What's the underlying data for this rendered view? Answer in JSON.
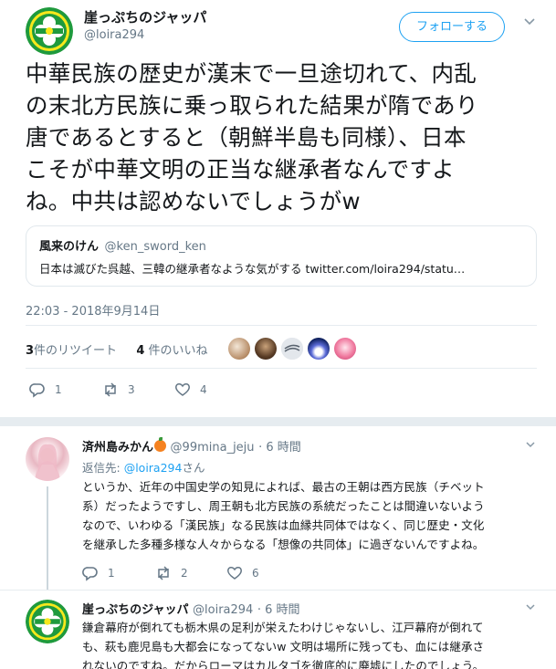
{
  "colors": {
    "brand": "#1da1f2",
    "muted": "#657786",
    "text": "#14171a",
    "avatar_green": "#1f9a3d",
    "avatar_yellow": "#f7e81c"
  },
  "main_tweet": {
    "author_name": "崖っぷちのジャッパ",
    "author_handle": "@loira294",
    "follow_label": "フォローする",
    "text": "中華民族の歴史が漢末で一旦途切れて、内乱\nの末北方民族に乗っ取られた結果が隋であり\n唐であるとすると（朝鮮半島も同様）、日本\nこそが中華文明の正当な継承者なんですよ\nね。中共は認めないでしょうがw",
    "quote": {
      "name": "風来のけん",
      "handle": "@ken_sword_ken",
      "text": "日本は滅びた呉越、三韓の継承者なような気がする twitter.com/loira294/statu…"
    },
    "timestamp": "22:03 - 2018年9月14日",
    "retweets_count": "3",
    "retweets_label": "件のリツイート",
    "likes_count": "4",
    "likes_label": "件のいいね",
    "likers": [
      "cat-avatar",
      "character-avatar",
      "logo-avatar",
      "night-avatar",
      "anime-avatar"
    ],
    "actions": {
      "replies": "1",
      "retweets": "3",
      "likes": "4"
    }
  },
  "replies": [
    {
      "author_name": "済州島みかん",
      "author_emoji": "orange-emoji",
      "author_handle": "@99mina_jeju",
      "time": "· 6 時間",
      "reply_to_label": "返信先:",
      "reply_to_handle": "@loira294",
      "reply_to_suffix": "さん",
      "text": "というか、近年の中国史学の知見によれば、最古の王朝は西方民族（チベット\n系）だったようですし、周王朝も北方民族の系統だったことは間違いないよう\nなので、いわゆる「漢民族」なる民族は血縁共同体ではなく、同じ歴史・文化\nを継承した多種多様な人々からなる「想像の共同体」に過ぎないんですよね。",
      "actions": {
        "replies": "1",
        "retweets": "2",
        "likes": "6"
      }
    },
    {
      "author_name": "崖っぷちのジャッパ",
      "author_handle": "@loira294",
      "time": "· 6 時間",
      "text": "鎌倉幕府が倒れても栃木県の足利が栄えたわけじゃないし、江戸幕府が倒れて\nも、萩も鹿児島も大都会になってないw 文明は場所に残っても、血には継承さ\nれないのですね。だからローマはカルタゴを徹底的に廃墟にしたのでしょう。"
    }
  ]
}
